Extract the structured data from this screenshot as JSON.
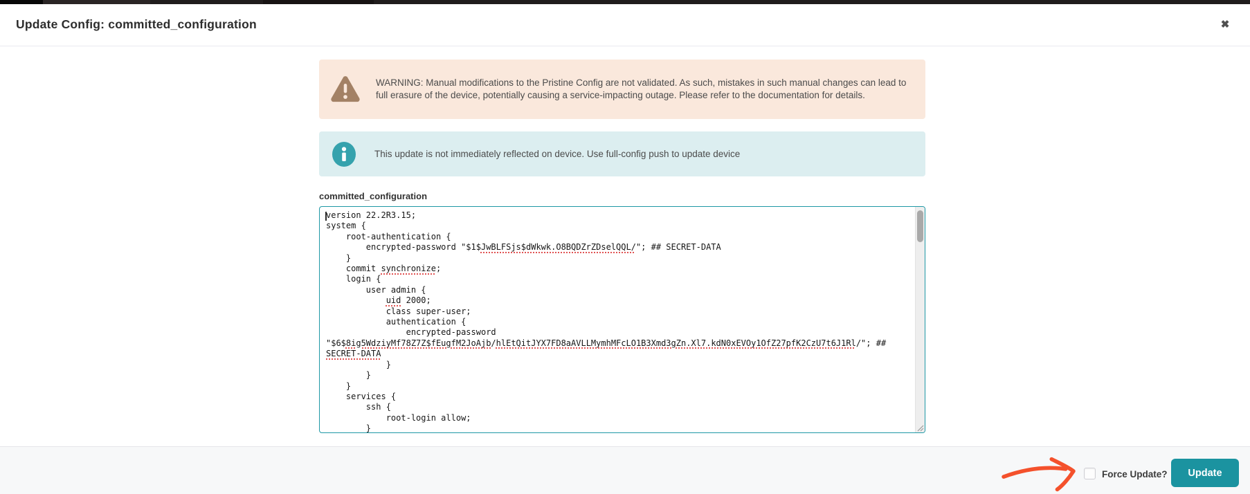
{
  "window": {
    "title": "Update Config: committed_configuration",
    "close_glyph": "✖"
  },
  "banners": {
    "warning": "WARNING: Manual modifications to the Pristine Config are not validated. As such, mistakes in such manual changes can lead to full erasure of the device, potentially causing a service-impacting outage. Please refer to the documentation for details.",
    "info": "This update is not immediately reflected on device. Use full-config push to update device"
  },
  "config_editor": {
    "label": "committed_configuration",
    "value": "version 22.2R3.15;\nsystem {\n    root-authentication {\n        encrypted-password \"$1$JwBLFSjs$dWkwk.O8BQDZrZDselQQL/\"; ## SECRET-DATA\n    }\n    commit synchronize;\n    login {\n        user admin {\n            uid 2000;\n            class super-user;\n            authentication {\n                encrypted-password\n\"$6$8ig5WdziyMf78Z7Z$fEugfM2JoAjb/hlEtQitJYX7FD8aAVLLMymhMFcLO1B3Xmd3gZn.Xl7.kdN0xEVOy1OfZ27pfK2CzU7t6J1Rl/\"; ##\nSECRET-DATA\n            }\n        }\n    }\n    services {\n        ssh {\n            root-login allow;\n        }",
    "spellcheck_flagged": [
      "JwBLFSjs$dWkwk.O8BQDZrZDselQQL/",
      "synchronize",
      "uid",
      "8ig5WdziyMf78Z7Z$fEugfM2JoAjb",
      "hlEtQitJYX7FD8aAVLLMymhMFcLO1B3Xmd3gZn.Xl7.kdN0xEVOy1OfZ27pfK2CzU7t6J1Rl",
      "\nSECRET-DATA"
    ]
  },
  "footer": {
    "force_update_label": "Force Update?",
    "force_update_checked": false,
    "update_label": "Update"
  },
  "colors": {
    "accent-teal": "#1b93a0",
    "teal-border": "#1d98a5",
    "warning-bg": "#fae8dc",
    "warning-icon": "#a38165",
    "info-bg": "#dceef0",
    "info-icon": "#35a2ad",
    "arrow": "#f4512c",
    "footer-bg": "#f7f8f9",
    "squiggle": "#e05252"
  }
}
